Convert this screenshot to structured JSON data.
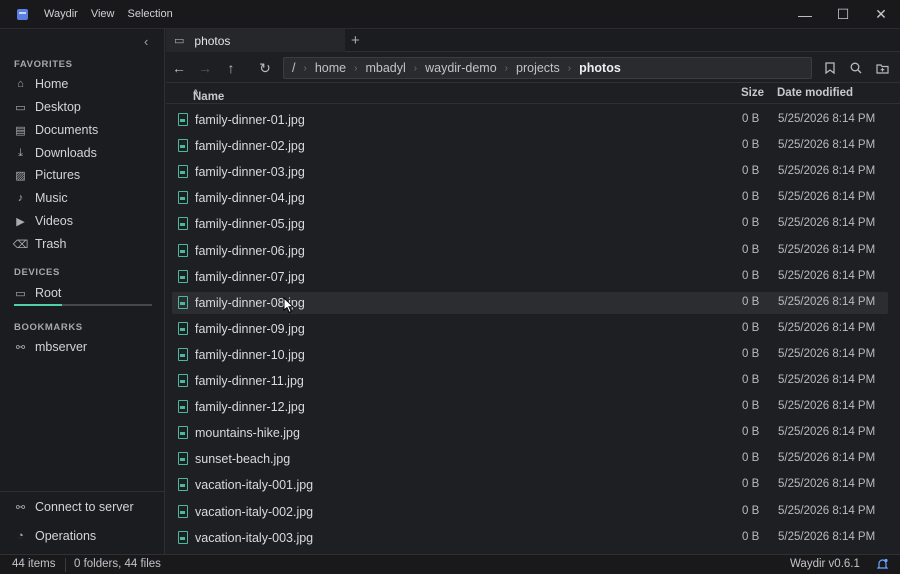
{
  "titlebar": {
    "menu": [
      "Waydir",
      "View",
      "Selection"
    ],
    "controls": {
      "minimize": "—",
      "maximize": "☐",
      "close": "✕"
    }
  },
  "sidebar": {
    "favorites_label": "FAVORITES",
    "favorites": [
      {
        "label": "Home",
        "icon": "home-icon"
      },
      {
        "label": "Desktop",
        "icon": "desktop-icon"
      },
      {
        "label": "Documents",
        "icon": "documents-icon"
      },
      {
        "label": "Downloads",
        "icon": "downloads-icon"
      },
      {
        "label": "Pictures",
        "icon": "pictures-icon"
      },
      {
        "label": "Music",
        "icon": "music-icon"
      },
      {
        "label": "Videos",
        "icon": "videos-icon"
      },
      {
        "label": "Trash",
        "icon": "trash-icon"
      }
    ],
    "devices_label": "DEVICES",
    "devices": [
      {
        "label": "Root",
        "icon": "drive-icon",
        "usage_fraction": 0.35
      }
    ],
    "bookmarks_label": "BOOKMARKS",
    "bookmarks": [
      {
        "label": "mbserver",
        "icon": "network-icon"
      }
    ],
    "connect_label": "Connect to server",
    "operations_label": "Operations"
  },
  "tabs": [
    {
      "label": "photos",
      "icon": "folder-icon"
    }
  ],
  "path": {
    "crumbs": [
      "/",
      "home",
      "mbadyl",
      "waydir-demo",
      "projects",
      "photos"
    ]
  },
  "columns": {
    "name": "Name",
    "name_sort": "^",
    "size": "Size",
    "date": "Date modified"
  },
  "files": [
    {
      "name": "family-dinner-01.jpg",
      "size": "0 B",
      "date": "5/25/2026 8:14 PM"
    },
    {
      "name": "family-dinner-02.jpg",
      "size": "0 B",
      "date": "5/25/2026 8:14 PM"
    },
    {
      "name": "family-dinner-03.jpg",
      "size": "0 B",
      "date": "5/25/2026 8:14 PM"
    },
    {
      "name": "family-dinner-04.jpg",
      "size": "0 B",
      "date": "5/25/2026 8:14 PM"
    },
    {
      "name": "family-dinner-05.jpg",
      "size": "0 B",
      "date": "5/25/2026 8:14 PM"
    },
    {
      "name": "family-dinner-06.jpg",
      "size": "0 B",
      "date": "5/25/2026 8:14 PM"
    },
    {
      "name": "family-dinner-07.jpg",
      "size": "0 B",
      "date": "5/25/2026 8:14 PM"
    },
    {
      "name": "family-dinner-08.jpg",
      "size": "0 B",
      "date": "5/25/2026 8:14 PM",
      "hover": true
    },
    {
      "name": "family-dinner-09.jpg",
      "size": "0 B",
      "date": "5/25/2026 8:14 PM"
    },
    {
      "name": "family-dinner-10.jpg",
      "size": "0 B",
      "date": "5/25/2026 8:14 PM"
    },
    {
      "name": "family-dinner-11.jpg",
      "size": "0 B",
      "date": "5/25/2026 8:14 PM"
    },
    {
      "name": "family-dinner-12.jpg",
      "size": "0 B",
      "date": "5/25/2026 8:14 PM"
    },
    {
      "name": "mountains-hike.jpg",
      "size": "0 B",
      "date": "5/25/2026 8:14 PM"
    },
    {
      "name": "sunset-beach.jpg",
      "size": "0 B",
      "date": "5/25/2026 8:14 PM"
    },
    {
      "name": "vacation-italy-001.jpg",
      "size": "0 B",
      "date": "5/25/2026 8:14 PM"
    },
    {
      "name": "vacation-italy-002.jpg",
      "size": "0 B",
      "date": "5/25/2026 8:14 PM"
    },
    {
      "name": "vacation-italy-003.jpg",
      "size": "0 B",
      "date": "5/25/2026 8:14 PM"
    }
  ],
  "status": {
    "items": "44 items",
    "summary": "0 folders, 44 files",
    "version": "Waydir v0.6.1"
  },
  "colors": {
    "accent": "#4fd1a5",
    "file_icon": "#4db8a0",
    "app_icon": "#5b7fe0"
  }
}
